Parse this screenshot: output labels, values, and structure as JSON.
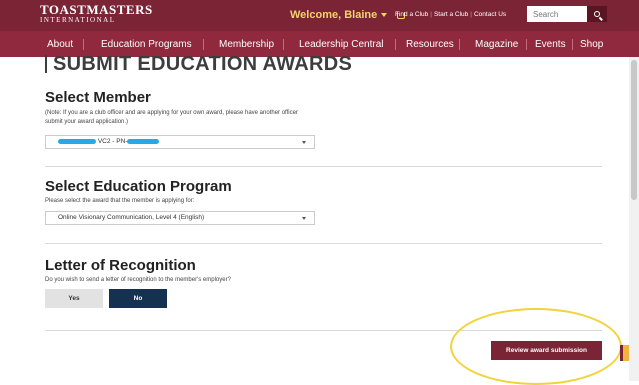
{
  "header": {
    "logo_main": "TOASTMASTERS",
    "logo_sub": "INTERNATIONAL",
    "welcome": "Welcome, Blaine",
    "utility_links": [
      "Find a Club",
      "Start a Club",
      "Contact Us"
    ],
    "search_placeholder": "Search"
  },
  "nav": {
    "items": [
      "About",
      "Education Programs",
      "Membership",
      "Leadership Central",
      "Resources",
      "Magazine",
      "Events",
      "Shop"
    ]
  },
  "page": {
    "title": "SUBMIT EDUCATION AWARDS"
  },
  "select_member": {
    "heading": "Select Member",
    "note": "(Note: If you are a club officer and are applying for your own award, please have another officer submit your award application.)",
    "value_visible": "VC2 - PN-"
  },
  "select_program": {
    "heading": "Select Education Program",
    "note": "Please select the award that the member is applying for:",
    "value": "Online Visionary Communication, Level 4 (English)"
  },
  "letter": {
    "heading": "Letter of Recognition",
    "question": "Do you wish to send a letter of recognition to the member's employer?",
    "yes_label": "Yes",
    "no_label": "No"
  },
  "actions": {
    "review_label": "Review award submission"
  },
  "colors": {
    "brand": "#7b2435",
    "nav": "#90293d",
    "accent_yellow": "#f3d36b",
    "selected_button": "#14324f",
    "annotation_ring": "#f1d33a"
  }
}
